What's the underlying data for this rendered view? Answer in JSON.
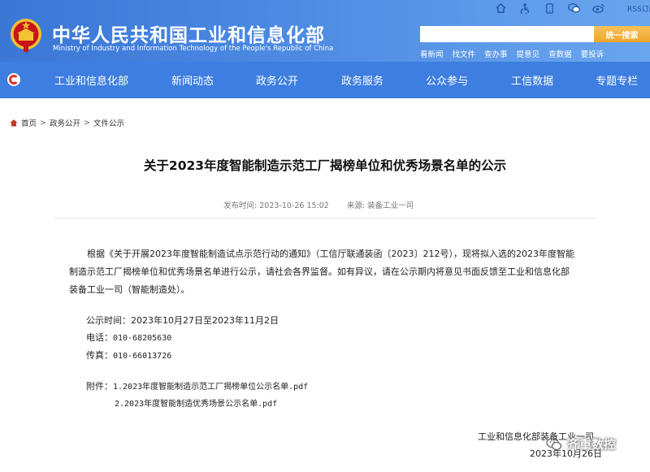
{
  "header": {
    "title": "中华人民共和国工业和信息化部",
    "subtitle": "Ministry of Industry and Information Technology of the People's Republic of China",
    "rss_label": "RSS订阅",
    "search_button": "统一搜索",
    "search_placeholder": "",
    "quick_links": [
      "看新闻",
      "找文件",
      "查办事",
      "提意见",
      "查数据",
      "要投诉"
    ],
    "top_icons": [
      "home-icon",
      "accessibility-icon",
      "mobile-icon",
      "wechat-icon",
      "weibo-icon"
    ]
  },
  "nav": {
    "items": [
      "工业和信息化部",
      "新闻动态",
      "政务公开",
      "政务服务",
      "公众参与",
      "工信数据",
      "专题专栏"
    ]
  },
  "breadcrumb": {
    "items": [
      "首页",
      "政务公开",
      "文件公示"
    ],
    "separator": ">"
  },
  "article": {
    "title": "关于2023年度智能制造示范工厂揭榜单位和优秀场景名单的公示",
    "publish_time_label": "发布时间:",
    "publish_time": "2023-10-26 15:02",
    "source_label": "来源:",
    "source": "装备工业一司",
    "body_lines": [
      "根据《关于开展2023年度智能制造试点示范行动的通知》（工信厅联通装函〔2023〕212号），现将拟入选的2023年度智能",
      "制造示范工厂揭榜单位和优秀场景名单进行公示，请社会各界监督。如有异议，请在公示期内将意见书面反馈至工业和信息化部",
      "装备工业一司（智能制造处）。"
    ],
    "period_label": "公示时间：",
    "period": "2023年10月27日至2023年11月2日",
    "phone_label": "电话：",
    "phone": "010-68205630",
    "fax_label": "传真：",
    "fax": "010-66013726",
    "attachments_label": "附件：",
    "attachments": [
      "1.2023年度智能制造示范工厂揭榜单位公示名单.pdf",
      "2.2023年度智能制造优秀场景公示名单.pdf"
    ],
    "signature": "工业和信息化部装备工业一司",
    "date": "2023年10月26日"
  },
  "watermark": {
    "text": "齐重数控"
  },
  "colors": {
    "header_bg": "#4a88e2",
    "nav_bg": "#3d7ee0",
    "search_button": "#f0a42a",
    "emblem_red": "#c8151b",
    "emblem_gold": "#f2c230"
  }
}
